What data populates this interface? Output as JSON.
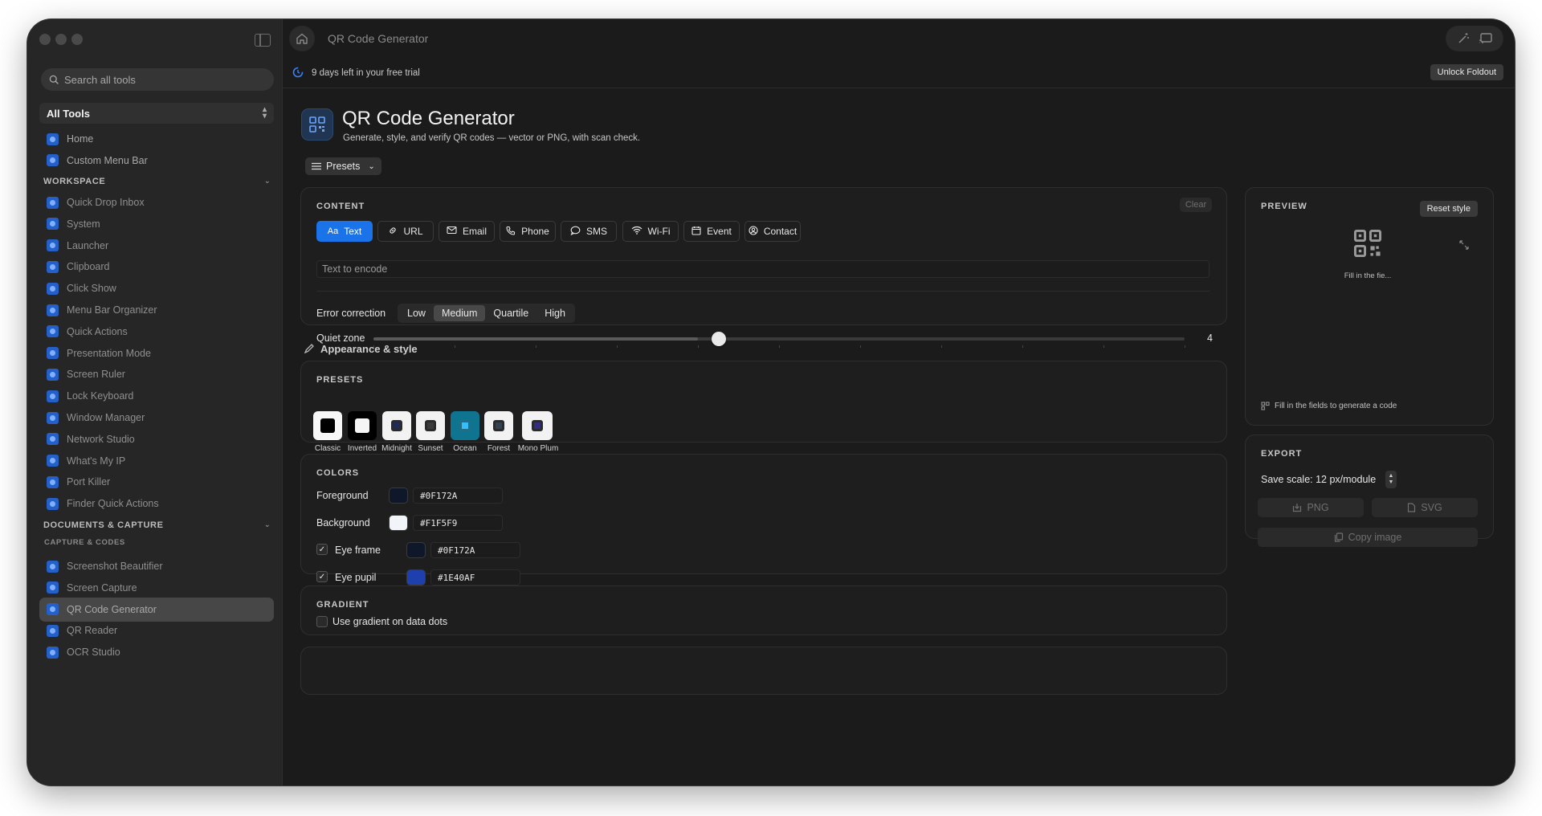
{
  "window": {
    "title": "QR Code Generator"
  },
  "sidebar": {
    "search_placeholder": "Search all tools",
    "scope": "All Tools",
    "top_items": [
      {
        "label": "Home",
        "icon": "home-icon"
      },
      {
        "label": "Custom Menu Bar",
        "icon": "menu-bar-icon"
      }
    ],
    "workspace_header": "WORKSPACE",
    "workspace_items": [
      "Quick Drop Inbox",
      "System",
      "Launcher",
      "Clipboard",
      "Click Show",
      "Menu Bar Organizer",
      "Quick Actions",
      "Presentation Mode",
      "Screen Ruler",
      "Lock Keyboard",
      "Window Manager",
      "Network Studio",
      "What's My IP",
      "Port Killer",
      "Finder Quick Actions"
    ],
    "docs_header": "DOCUMENTS & CAPTURE",
    "capture_subheader": "CAPTURE & CODES",
    "capture_items": [
      "Screenshot Beautifier",
      "Screen Capture",
      "QR Code Generator",
      "QR Reader",
      "OCR Studio"
    ],
    "selected": "QR Code Generator"
  },
  "trial": {
    "text": "9 days left in your free trial",
    "button": "Unlock Foldout"
  },
  "header": {
    "title": "QR Code Generator",
    "subtitle": "Generate, style, and verify QR codes — vector or PNG, with scan check.",
    "presets_label": "Presets"
  },
  "content": {
    "label": "CONTENT",
    "clear_label": "Clear",
    "types": [
      {
        "label": "Text",
        "icon": "Aa",
        "active": true
      },
      {
        "label": "URL",
        "icon": "link-icon"
      },
      {
        "label": "Email",
        "icon": "mail-icon"
      },
      {
        "label": "Phone",
        "icon": "phone-icon"
      },
      {
        "label": "SMS",
        "icon": "message-icon"
      },
      {
        "label": "Wi-Fi",
        "icon": "wifi-icon"
      },
      {
        "label": "Event",
        "icon": "calendar-icon"
      },
      {
        "label": "Contact",
        "icon": "contact-icon"
      }
    ],
    "text_placeholder": "Text to encode",
    "error_correction_label": "Error correction",
    "error_levels": [
      "Low",
      "Medium",
      "Quartile",
      "High"
    ],
    "error_selected": "Medium",
    "quiet_zone_label": "Quiet zone",
    "quiet_zone_value": "4",
    "quiet_zone_fraction": 0.4
  },
  "appearance": {
    "title": "Appearance & style"
  },
  "presets": {
    "label": "PRESETS",
    "items": [
      {
        "name": "Classic",
        "bg": "#f7f7f7",
        "fg": "#000000"
      },
      {
        "name": "Inverted",
        "bg": "#000000",
        "fg": "#f5f5f5"
      },
      {
        "name": "Midnight",
        "bg": "#f2f2f2",
        "fg": "#1e2a5a"
      },
      {
        "name": "Sunset",
        "bg": "#f2f2f2",
        "fg": "#3a3a3a"
      },
      {
        "name": "Ocean",
        "bg": "#0e7490",
        "fg": "#38bdf8"
      },
      {
        "name": "Forest",
        "bg": "#f2f2f2",
        "fg": "#334155"
      },
      {
        "name": "Mono Plum",
        "bg": "#f2f2f2",
        "fg": "#312e81"
      }
    ]
  },
  "colors": {
    "label": "COLORS",
    "rows": [
      {
        "label": "Foreground",
        "hex": "#0F172A",
        "checkbox": false
      },
      {
        "label": "Background",
        "hex": "#F1F5F9",
        "checkbox": false
      },
      {
        "label": "Eye frame",
        "hex": "#0F172A",
        "checkbox": true
      },
      {
        "label": "Eye pupil",
        "hex": "#1E40AF",
        "checkbox": true
      }
    ]
  },
  "gradient": {
    "label": "GRADIENT",
    "option": "Use gradient on data dots"
  },
  "preview": {
    "label": "PREVIEW",
    "reset_label": "Reset style",
    "placeholder_short": "Fill in the fie...",
    "hint": "Fill in the fields to generate a code"
  },
  "export": {
    "label": "EXPORT",
    "scale_label": "Save scale: 12 px/module",
    "png_label": "PNG",
    "svg_label": "SVG",
    "copy_label": "Copy image"
  },
  "colors_accent": {
    "accent": "#1A73E8",
    "bg": "#1B1B1B",
    "sidebar": "#262626"
  }
}
